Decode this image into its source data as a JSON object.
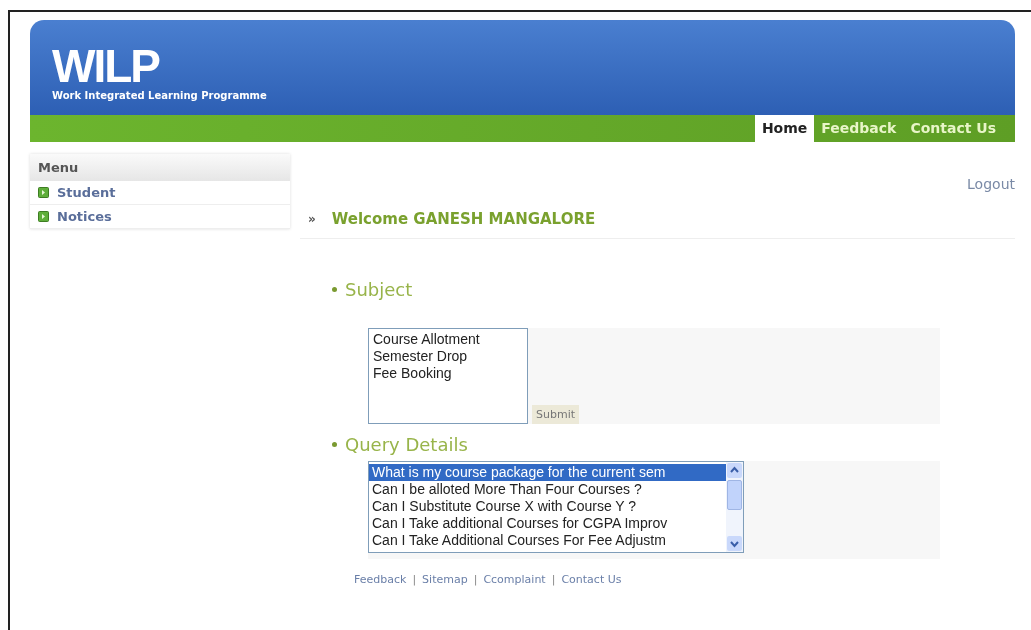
{
  "header": {
    "logo": "WILP",
    "tagline": "Work Integrated Learning Programme"
  },
  "nav": [
    {
      "label": "Home",
      "selected": true
    },
    {
      "label": "Feedback",
      "selected": false
    },
    {
      "label": "Contact Us",
      "selected": false
    }
  ],
  "sidebar": {
    "title": "Menu",
    "items": [
      {
        "label": "Student"
      },
      {
        "label": "Notices"
      }
    ]
  },
  "logout": "Logout",
  "welcome": {
    "marker": "»",
    "text": "Welcome GANESH MANGALORE"
  },
  "subject": {
    "heading": "Subject",
    "options": [
      {
        "label": "Course Allotment",
        "selected": false
      },
      {
        "label": "Semester Drop",
        "selected": false
      },
      {
        "label": "Fee Booking",
        "selected": false
      }
    ],
    "button": "Submit"
  },
  "query": {
    "heading": "Query Details",
    "options": [
      {
        "label": "What is my course package for the current sem",
        "selected": true
      },
      {
        "label": "Can I be alloted More Than Four Courses ?",
        "selected": false
      },
      {
        "label": "Can I Substitute Course X with Course Y ?",
        "selected": false
      },
      {
        "label": "Can I Take additional Courses for CGPA Improv",
        "selected": false
      },
      {
        "label": "Can I Take Additional Courses For Fee Adjustm",
        "selected": false
      }
    ]
  },
  "footer": [
    {
      "kind": "link",
      "text": "Feedback"
    },
    {
      "kind": "separator",
      "text": "|"
    },
    {
      "kind": "link",
      "text": "Sitemap"
    },
    {
      "kind": "separator",
      "text": "|"
    },
    {
      "kind": "link",
      "text": "Ccomplaint"
    },
    {
      "kind": "separator",
      "text": "|"
    },
    {
      "kind": "link",
      "text": "Contact Us"
    }
  ]
}
